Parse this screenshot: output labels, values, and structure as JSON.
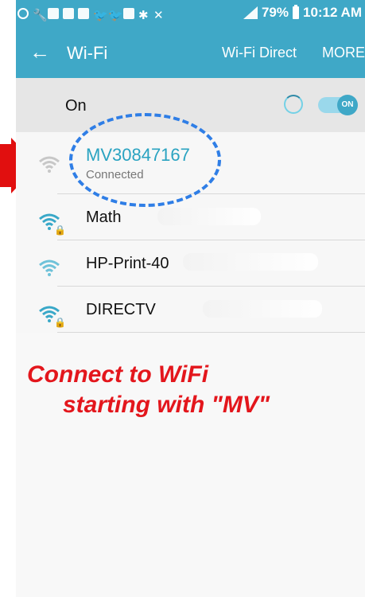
{
  "status_bar": {
    "battery": "79%",
    "time": "10:12 AM"
  },
  "app_bar": {
    "title": "Wi-Fi",
    "wifi_direct": "Wi-Fi Direct",
    "more": "MORE"
  },
  "toggle": {
    "label": "On",
    "switch": "ON"
  },
  "networks": [
    {
      "ssid": "MV30847167",
      "status": "Connected"
    },
    {
      "ssid": "Math"
    },
    {
      "ssid": "HP-Print-40"
    },
    {
      "ssid": "DIRECTV"
    }
  ],
  "annotation": {
    "line1": "Connect to WiFi",
    "line2": "starting with \"MV\""
  },
  "colors": {
    "accent": "#3fa8c7",
    "connected_text": "#2aa3c1",
    "annotation_red": "#e3161c",
    "dashed_blue": "#2f7ee6"
  }
}
